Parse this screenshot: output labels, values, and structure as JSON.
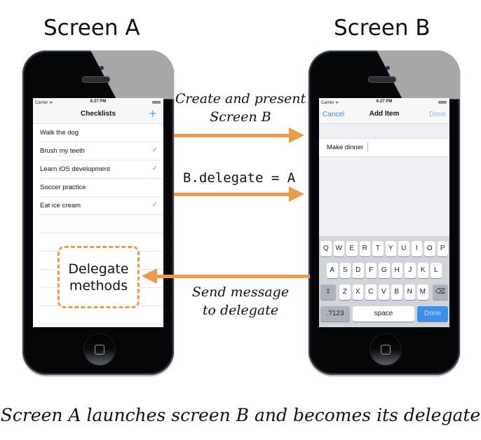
{
  "titles": {
    "screen_a": "Screen A",
    "screen_b": "Screen B"
  },
  "colors": {
    "arrow": "#ee9a4d",
    "ios_blue": "#3a8ef0"
  },
  "screen_a": {
    "status": {
      "carrier": "Carrier ᯤ",
      "time": "6:27 PM"
    },
    "nav_title": "Checklists",
    "add_icon": "+",
    "items": [
      {
        "label": "Walk the dog",
        "checked": false
      },
      {
        "label": "Brush my teeth",
        "checked": true
      },
      {
        "label": "Learn iOS development",
        "checked": true
      },
      {
        "label": "Soccer practice",
        "checked": false
      },
      {
        "label": "Eat ice cream",
        "checked": true
      }
    ],
    "check_glyph": "✓"
  },
  "screen_b": {
    "status": {
      "carrier": "Carrier ᯤ",
      "time": "6:27 PM"
    },
    "cancel": "Cancel",
    "nav_title": "Add Item",
    "done": "Done",
    "text_value": "Make dinner",
    "keyboard": {
      "row1": [
        "Q",
        "W",
        "E",
        "R",
        "T",
        "Y",
        "U",
        "I",
        "O",
        "P"
      ],
      "row2": [
        "A",
        "S",
        "D",
        "F",
        "G",
        "H",
        "J",
        "K",
        "L"
      ],
      "row3": [
        "Z",
        "X",
        "C",
        "V",
        "B",
        "N",
        "M"
      ],
      "shift": "⇧",
      "backspace": "⌫",
      "numbers": ".?123",
      "space": "space",
      "done": "Done"
    }
  },
  "arrows": {
    "create_label_line1": "Create and present",
    "create_label_line2": "Screen B",
    "delegate_assign": "B.delegate = A",
    "send_label_line1": "Send message",
    "send_label_line2": "to delegate"
  },
  "delegate_box": {
    "line1": "Delegate",
    "line2": "methods"
  },
  "caption": "Screen A launches screen B and becomes its delegate"
}
